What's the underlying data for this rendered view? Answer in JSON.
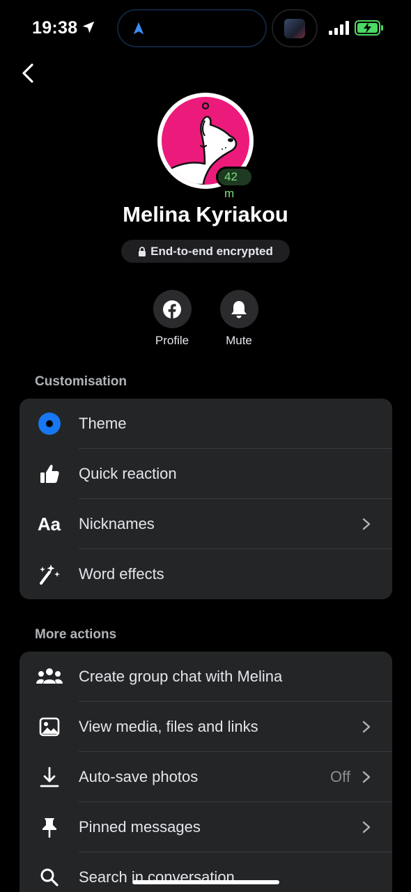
{
  "status": {
    "time": "19:38"
  },
  "header": {
    "back_icon": "chevron-left-icon"
  },
  "contact": {
    "name": "Melina Kyriakou",
    "active_badge": "42 m",
    "encryption_label": "End-to-end encrypted"
  },
  "actions": [
    {
      "label": "Profile",
      "icon": "facebook-icon"
    },
    {
      "label": "Mute",
      "icon": "bell-icon"
    }
  ],
  "customisation": {
    "title": "Customisation",
    "items": [
      {
        "label": "Theme",
        "icon": "theme-dot-icon"
      },
      {
        "label": "Quick reaction",
        "icon": "thumbs-up-icon"
      },
      {
        "label": "Nicknames",
        "icon": "aa-text-icon",
        "chevron": true
      },
      {
        "label": "Word effects",
        "icon": "sparkle-wand-icon"
      }
    ]
  },
  "more_actions": {
    "title": "More actions",
    "items": [
      {
        "label": "Create group chat with Melina",
        "icon": "group-icon"
      },
      {
        "label": "View media, files and links",
        "icon": "image-icon",
        "chevron": true
      },
      {
        "label": "Auto-save photos",
        "icon": "download-icon",
        "value": "Off",
        "chevron": true
      },
      {
        "label": "Pinned messages",
        "icon": "pin-icon",
        "chevron": true
      },
      {
        "label": "Search in conversation",
        "icon": "search-icon"
      }
    ]
  },
  "colors": {
    "accent": "#1877f2",
    "avatar_bg": "#ec1b7b",
    "active_green": "#7be07a",
    "card_bg": "#242527"
  }
}
